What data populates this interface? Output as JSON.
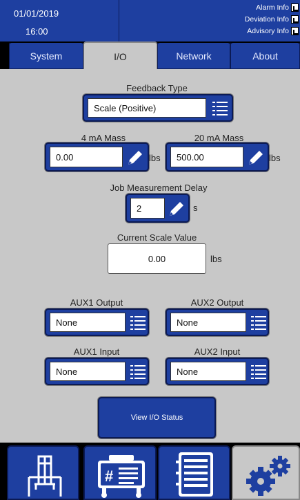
{
  "header": {
    "date": "01/01/2019",
    "time": "16:00",
    "info": [
      {
        "label": "Alarm Info",
        "icon": "info-doc-icon"
      },
      {
        "label": "Deviation Info",
        "icon": "info-doc-icon"
      },
      {
        "label": "Advisory Info",
        "icon": "info-doc-icon"
      }
    ]
  },
  "tabs": [
    {
      "label": "System",
      "active": false
    },
    {
      "label": "I/O",
      "active": true
    },
    {
      "label": "Network",
      "active": false
    },
    {
      "label": "About",
      "active": false
    }
  ],
  "io": {
    "feedback_type": {
      "label": "Feedback Type",
      "value": "Scale (Positive)"
    },
    "mass_4ma": {
      "label": "4 mA Mass",
      "value": "0.00",
      "unit": "lbs"
    },
    "mass_20ma": {
      "label": "20 mA Mass",
      "value": "500.00",
      "unit": "lbs"
    },
    "job_delay": {
      "label": "Job Measurement Delay",
      "value": "2",
      "unit": "s"
    },
    "scale_value": {
      "label": "Current Scale Value",
      "value": "0.00",
      "unit": "lbs"
    },
    "aux1_output": {
      "label": "AUX1 Output",
      "value": "None"
    },
    "aux2_output": {
      "label": "AUX2 Output",
      "value": "None"
    },
    "aux1_input": {
      "label": "AUX1 Input",
      "value": "None"
    },
    "aux2_input": {
      "label": "AUX2 Input",
      "value": "None"
    },
    "view_status_label": "View I/O Status"
  },
  "nav": [
    {
      "icon": "machine-icon",
      "active": false
    },
    {
      "icon": "controller-icon",
      "active": false
    },
    {
      "icon": "notebook-icon",
      "active": false
    },
    {
      "icon": "settings-gears-icon",
      "active": true
    }
  ],
  "colors": {
    "primary_blue": "#1e3fa0",
    "panel_gray": "#c8c8c8",
    "dark_border": "#0b1a55"
  }
}
